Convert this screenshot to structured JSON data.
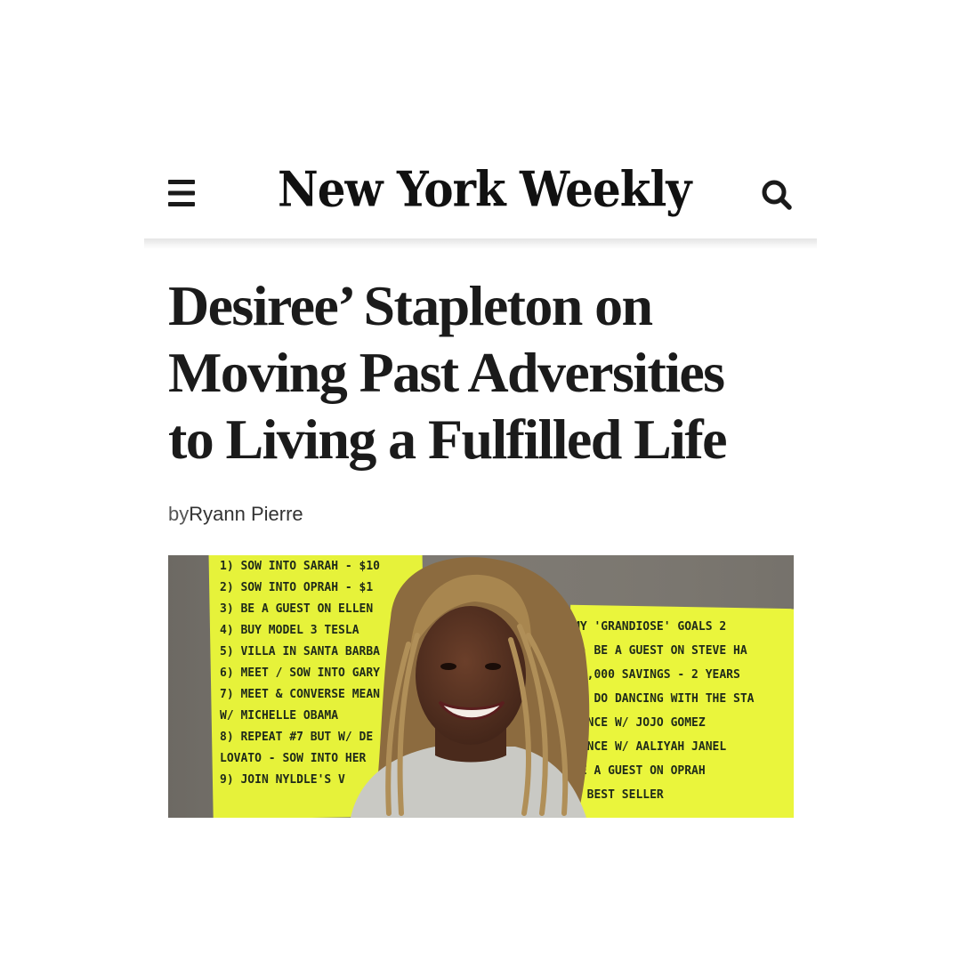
{
  "header": {
    "site_name": "New York Weekly",
    "menu_icon": "hamburger-menu-icon",
    "search_icon": "search-icon"
  },
  "article": {
    "headline_lines": [
      "Desiree’ Stapleton on",
      "Moving Past Adversities",
      "to Living a Fulfilled Life"
    ],
    "byline_prefix": "by",
    "author": "Ryann Pierre"
  },
  "featured_image": {
    "subject": "photo-of-woman-smiling-in-front-of-handwritten-goal-sheets",
    "left_sheet_lines": [
      "1) SOW INTO SARAH - $10",
      "2) SOW INTO OPRAH - $1",
      "3) BE A GUEST ON ELLEN",
      "4) BUY MODEL 3 TESLA",
      "5) VILLA IN SANTA BARBA",
      "6) MEET / SOW INTO GARY V",
      "7) MEET & CONVERSE MEAN",
      "   W/ MICHELLE OBAMA",
      "8) REPEAT #7 BUT W/ DE",
      "   LOVATO - SOW INTO HER",
      "9) JOIN NYLDLE'S V"
    ],
    "right_sheet_lines": [
      "MY 'GRANDIOSE' GOALS 2",
      "1) BE A GUEST ON STEVE HA",
      "10,000 SAVINGS - 2 YEARS",
      "TO DO DANCING WITH THE STA",
      "DANCE W/ JOJO GOMEZ",
      "DANCE W/ AALIYAH JANEL",
      "BE A GUEST ON OPRAH",
      "A BEST SELLER"
    ],
    "colors": {
      "sheet": "#e9f53a",
      "wall": "#7b7770",
      "hair": "#9a7a4a",
      "shirt": "#c9c9c4"
    }
  }
}
